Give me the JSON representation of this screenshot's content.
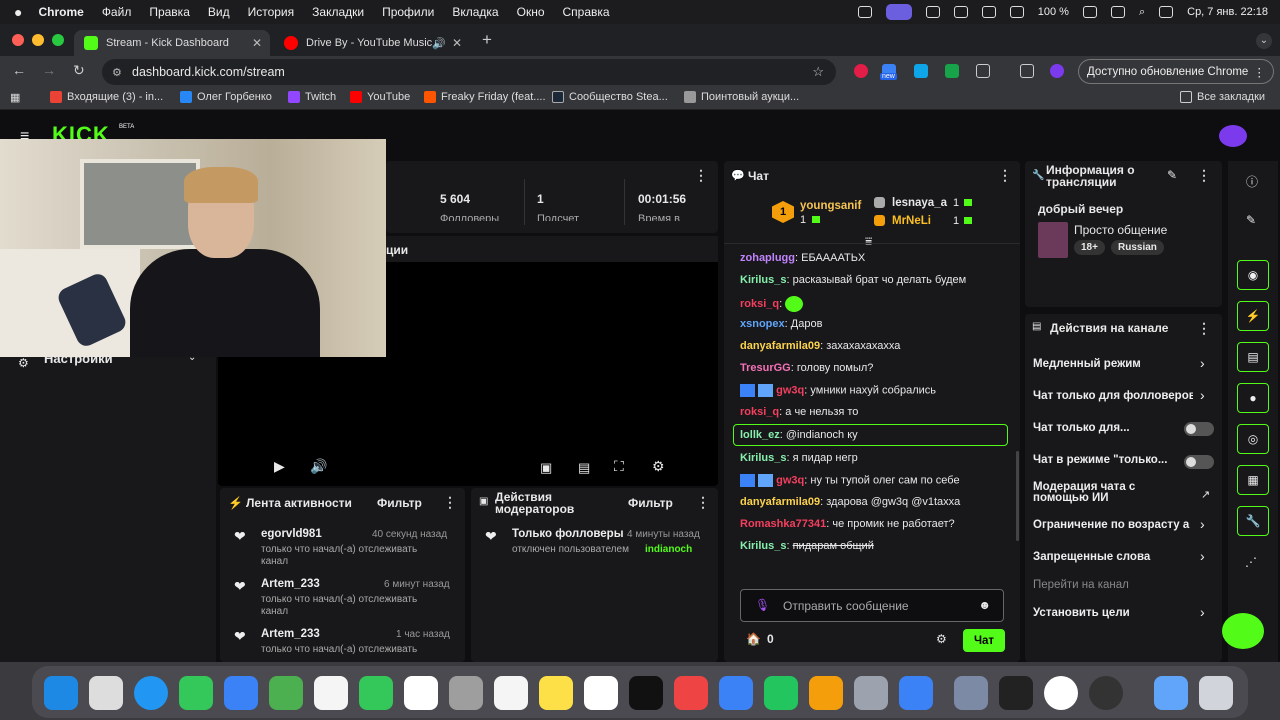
{
  "menubar": {
    "app": "Chrome",
    "items": [
      "Файл",
      "Правка",
      "Вид",
      "История",
      "Закладки",
      "Профили",
      "Вкладка",
      "Окно",
      "Справка"
    ],
    "battery": "100 %",
    "datetime": "Ср, 7 янв.  22:18"
  },
  "tabs": [
    {
      "title": "Stream - Kick Dashboard",
      "active": true
    },
    {
      "title": "Drive By - YouTube Music",
      "active": false
    }
  ],
  "toolbar": {
    "url": "dashboard.kick.com/stream",
    "update_label": "Доступно обновление Chrome",
    "ext_badge": "new"
  },
  "bookmarks": [
    "Входящие (3) - in...",
    "Олег Горбенко",
    "Twitch",
    "YouTube",
    "Freaky Friday (feat....",
    "Сообщество Stea...",
    "Поинтовый аукци..."
  ],
  "bookmarks_all": "Все закладки",
  "kick": {
    "logo": "KICK",
    "logo_beta": "BETA",
    "stats": [
      {
        "value": "5 604",
        "label": "Фолловеры"
      },
      {
        "value": "1",
        "label": "Подсчет"
      },
      {
        "value": "00:01:56",
        "label": "Время в"
      }
    ],
    "partial_title": "ции",
    "settings_label": "Настройки"
  },
  "activity": {
    "title": "Лента активности",
    "filter": "Фильтр",
    "items": [
      {
        "name": "egorvld981",
        "time": "40 секунд назад",
        "text": "только что начал(-а) отслеживать канал"
      },
      {
        "name": "Artem_233",
        "time": "6 минут назад",
        "text": "только что начал(-а) отслеживать канал"
      },
      {
        "name": "Artem_233",
        "time": "1 час назад",
        "text": "только что начал(-а) отслеживать"
      }
    ]
  },
  "modactions": {
    "title": "Действия модераторов",
    "filter": "Фильтр",
    "item_title": "Только фолловеры",
    "item_time": "4 минуты назад",
    "item_text": "отключен пользователем",
    "item_user": "indianoch"
  },
  "chat": {
    "title": "Чат",
    "leaders": [
      {
        "name": "youngsanif",
        "count": "1",
        "rank": "1"
      },
      {
        "name": "lesnaya_a",
        "count": "1"
      },
      {
        "name": "MrNeLi",
        "count": "1"
      }
    ],
    "messages": [
      {
        "user": "zohaplugg",
        "color": "#c084fc",
        "text": "ЕБАААATЬX"
      },
      {
        "user": "Kirilus_s",
        "color": "#86efac",
        "text": "расказывай брат чо делать будем"
      },
      {
        "user": "roksi_q",
        "color": "#f43f5e",
        "text": ""
      },
      {
        "user": "xsnopex",
        "color": "#60a5fa",
        "text": "Даров"
      },
      {
        "user": "danyafarmila09",
        "color": "#fcd34d",
        "text": "захахахахахха"
      },
      {
        "user": "TresurGG",
        "color": "#f472b6",
        "text": "голову помыл?"
      },
      {
        "user": "gw3q",
        "color": "#f43f5e",
        "text": "умники нахуй собрались"
      },
      {
        "user": "roksi_q",
        "color": "#f43f5e",
        "text": "а че нельзя то"
      },
      {
        "user": "lollk_ez",
        "color": "#86efac",
        "text": "@indianoch ку"
      },
      {
        "user": "Kirilus_s",
        "color": "#86efac",
        "text": "я пидар негр"
      },
      {
        "user": "gw3q",
        "color": "#f43f5e",
        "text": "ну ты тупой олег сам по себе"
      },
      {
        "user": "danyafarmila09",
        "color": "#fcd34d",
        "text": "здарова @gw3q @v1taxxa"
      },
      {
        "user": "Romashka77341",
        "color": "#f43f5e",
        "text": "че промик не работает?"
      },
      {
        "user": "Kirilus_s",
        "color": "#86efac",
        "text": "пидарам общий"
      }
    ],
    "input_placeholder": "Отправить сообщение",
    "points": "0",
    "send": "Чат"
  },
  "info": {
    "title": "Информация о трансляции",
    "stream_title": "добрый вечер",
    "category": "Просто общение",
    "tags": [
      "18+",
      "Russian"
    ]
  },
  "actions": {
    "title": "Действия на канале",
    "items": [
      "Медленный режим",
      "Чат только для фолловеров",
      "Чат только для...",
      "Чат в режиме \"только...",
      "Модерация чата с помощью ИИ",
      "Ограничение по возрасту а",
      "Запрещенные слова",
      "Перейти на канал",
      "Установить цели"
    ]
  },
  "colors": {
    "kick_green": "#53fc18",
    "panel": "#18181b",
    "bg": "#0e0e10"
  }
}
